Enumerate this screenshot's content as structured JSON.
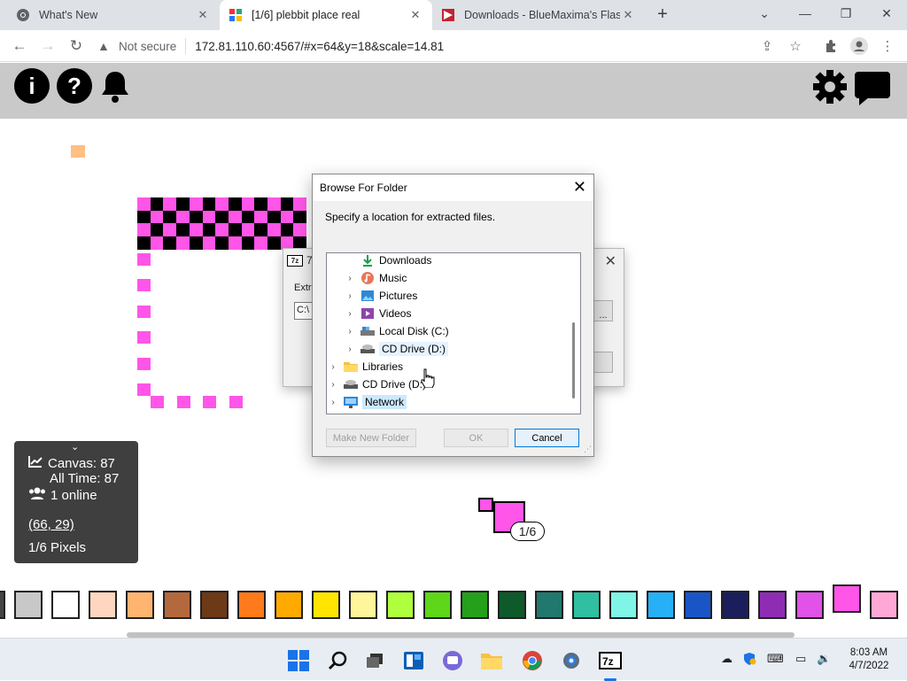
{
  "browser": {
    "tabs": [
      {
        "title": "What's New",
        "icon": "chrome-icon",
        "active": false
      },
      {
        "title": "[1/6] plebbit place real",
        "icon": "plebbit-favicon",
        "active": true
      },
      {
        "title": "Downloads - BlueMaxima's Flash",
        "icon": "flashpoint-icon",
        "active": false
      }
    ],
    "new_tab": "+",
    "security_label": "Not secure",
    "url": "172.81.110.60:4567/#x=64&y=18&scale=14.81"
  },
  "page": {
    "header_icons": [
      "info-icon",
      "help-icon",
      "bell-icon",
      "gear-icon",
      "chat-icon"
    ],
    "stats": {
      "canvas": "Canvas: 87",
      "all_time": "All Time: 87",
      "online": "1 online",
      "coords": "(66, 29)",
      "pixels": "1/6 Pixels"
    },
    "cursor_label": "1/6",
    "palette": [
      "#444444",
      "#c8c8c8",
      "#ffffff",
      "#ffd6bf",
      "#ffb470",
      "#b4683d",
      "#6d3a17",
      "#ff7a1a",
      "#ffaa00",
      "#ffe500",
      "#fff59a",
      "#b0ff3e",
      "#5ed61a",
      "#24a01a",
      "#0e5a2a",
      "#21786e",
      "#2ec0a0",
      "#7ff5e8",
      "#27b0f5",
      "#1a55c8",
      "#1a1e5a",
      "#8e2cb4",
      "#e052e8",
      "#ff55e8",
      "#ffa8d6"
    ],
    "accent": "#ff55e8"
  },
  "zip_dialog": {
    "title": "7-",
    "extract_label": "Extra",
    "path_value": "C:\\",
    "browse_btn": "..."
  },
  "browse_dialog": {
    "title": "Browse For Folder",
    "prompt": "Specify a location for extracted files.",
    "tree": [
      {
        "label": "Downloads",
        "icon": "download-icon",
        "level": 1,
        "expander": false
      },
      {
        "label": "Music",
        "icon": "music-icon",
        "level": 1,
        "expander": true
      },
      {
        "label": "Pictures",
        "icon": "pictures-icon",
        "level": 1,
        "expander": true
      },
      {
        "label": "Videos",
        "icon": "videos-icon",
        "level": 1,
        "expander": true
      },
      {
        "label": "Local Disk (C:)",
        "icon": "drive-icon",
        "level": 1,
        "expander": true
      },
      {
        "label": "CD Drive (D:)",
        "icon": "cd-drive-icon",
        "level": 1,
        "expander": true
      },
      {
        "label": "Libraries",
        "icon": "folder-icon",
        "level": 0,
        "expander": true
      },
      {
        "label": "CD Drive (D:)",
        "icon": "cd-drive-icon",
        "level": 0,
        "expander": true
      },
      {
        "label": "Network",
        "icon": "network-icon",
        "level": 0,
        "expander": true
      }
    ],
    "buttons": {
      "make_new_folder": "Make New Folder",
      "ok": "OK",
      "cancel": "Cancel"
    }
  },
  "taskbar": {
    "apps": [
      "windows-start-icon",
      "search-icon",
      "task-view-icon",
      "widgets-icon",
      "teams-chat-icon",
      "file-explorer-icon",
      "chrome-icon",
      "settings-icon",
      "7zip-icon"
    ],
    "tray": [
      "onedrive-icon",
      "security-icon",
      "keyboard-icon",
      "display-icon",
      "volume-icon"
    ],
    "time": "8:03 AM",
    "date": "4/7/2022"
  }
}
